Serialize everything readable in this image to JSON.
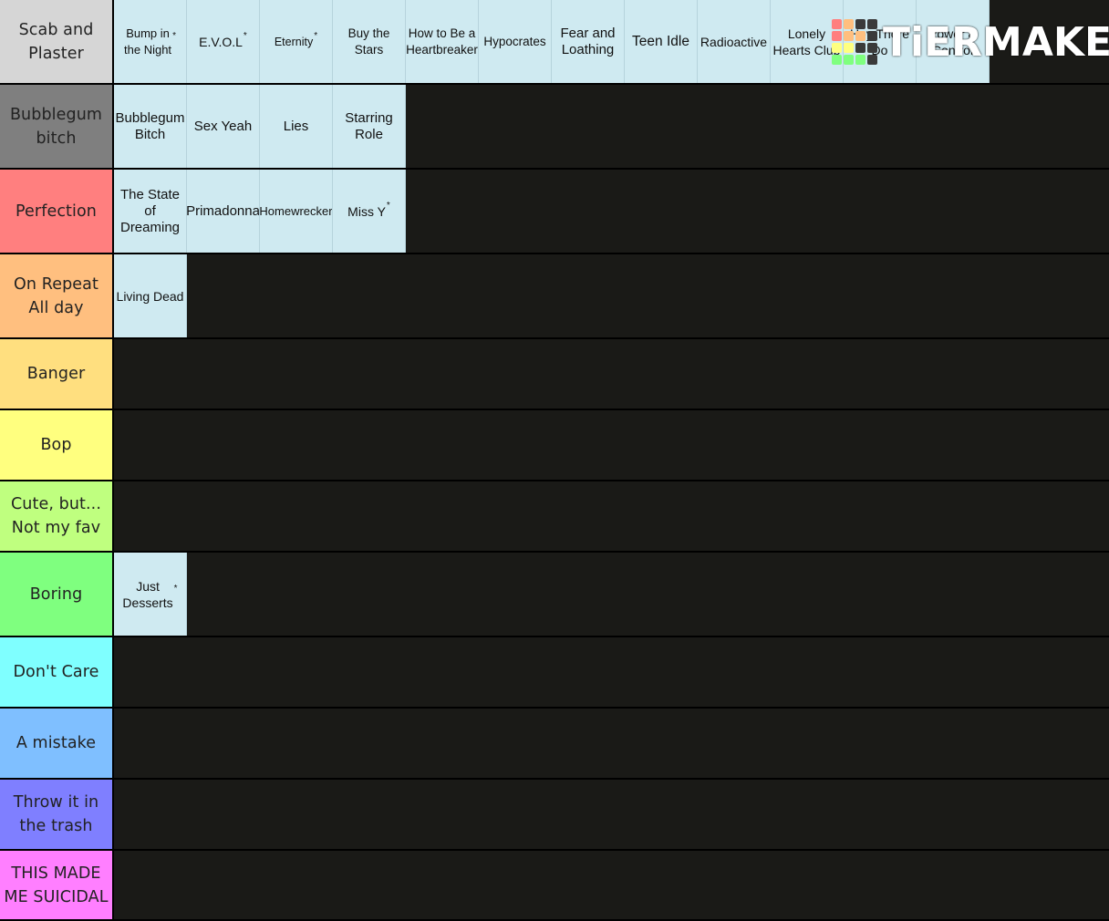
{
  "brand": {
    "name": "TiERMAKER",
    "logo_colors": [
      "#ff7f7f",
      "#ffbf7f",
      "#3a3a3a",
      "#3a3a3a",
      "#ff7f7f",
      "#ffbf7f",
      "#ffbf7f",
      "#3a3a3a",
      "#ffff7f",
      "#ffff7f",
      "#3a3a3a",
      "#3a3a3a",
      "#7fff7f",
      "#7fff7f",
      "#7fff7f",
      "#3a3a3a"
    ]
  },
  "tiers": [
    {
      "label": "Scab and Plaster",
      "color": "#d6d6d6",
      "items": [
        {
          "text": "Bump in\nthe Night",
          "star": true,
          "size": 13
        },
        {
          "text": "E.V.O.L",
          "star": true,
          "size": 14
        },
        {
          "text": "Eternity",
          "star": true,
          "size": 12.5
        },
        {
          "text": "Buy the Stars",
          "star": false,
          "size": 13.5
        },
        {
          "text": "How to Be a\nHeartbreaker",
          "star": false,
          "size": 13.5
        },
        {
          "text": "Hypocrates",
          "star": false,
          "size": 13.5
        },
        {
          "text": "Fear and\nLoathing",
          "star": false,
          "size": 15
        },
        {
          "text": "Teen Idle",
          "star": false,
          "size": 15.5
        },
        {
          "text": "Radioactive",
          "star": false,
          "size": 14
        },
        {
          "text": "Lonely\nHearts Club",
          "star": false,
          "size": 14
        },
        {
          "text": "Hey There\nDo",
          "star": false,
          "size": 14
        },
        {
          "text": "Power &\nControl",
          "star": false,
          "size": 14
        }
      ]
    },
    {
      "label": "Bubblegum bitch",
      "color": "#7f7f7f",
      "items": [
        {
          "text": "Bubblegum\nBitch",
          "star": false,
          "size": 15
        },
        {
          "text": "Sex Yeah",
          "star": false,
          "size": 15
        },
        {
          "text": "Lies",
          "star": false,
          "size": 15
        },
        {
          "text": "Starring\nRole",
          "star": false,
          "size": 15
        }
      ]
    },
    {
      "label": "Perfection",
      "color": "#ff7f7f",
      "items": [
        {
          "text": "The State\nof Dreaming",
          "star": false,
          "size": 15
        },
        {
          "text": "Primadonna",
          "star": false,
          "size": 15
        },
        {
          "text": "Homewrecker",
          "star": false,
          "size": 13
        },
        {
          "text": "Miss Y",
          "star": true,
          "size": 14
        }
      ]
    },
    {
      "label": "On Repeat All day",
      "color": "#ffbf7f",
      "items": [
        {
          "text": "Living Dead",
          "star": false,
          "size": 14
        }
      ]
    },
    {
      "label": "Banger",
      "color": "#ffdf7f",
      "items": []
    },
    {
      "label": "Bop",
      "color": "#ffff7f",
      "items": []
    },
    {
      "label": "Cute, but... Not my fav",
      "color": "#bfff7f",
      "items": []
    },
    {
      "label": "Boring",
      "color": "#7fff7f",
      "items": [
        {
          "text": "Just\nDesserts",
          "star": true,
          "size": 14
        }
      ]
    },
    {
      "label": "Don't Care",
      "color": "#7fffff",
      "items": []
    },
    {
      "label": "A mistake",
      "color": "#7fbfff",
      "items": []
    },
    {
      "label": "Throw it in the trash",
      "color": "#7f7fff",
      "items": []
    },
    {
      "label": "THIS MADE ME SUICIDAL",
      "color": "#ff7fff",
      "items": []
    }
  ]
}
